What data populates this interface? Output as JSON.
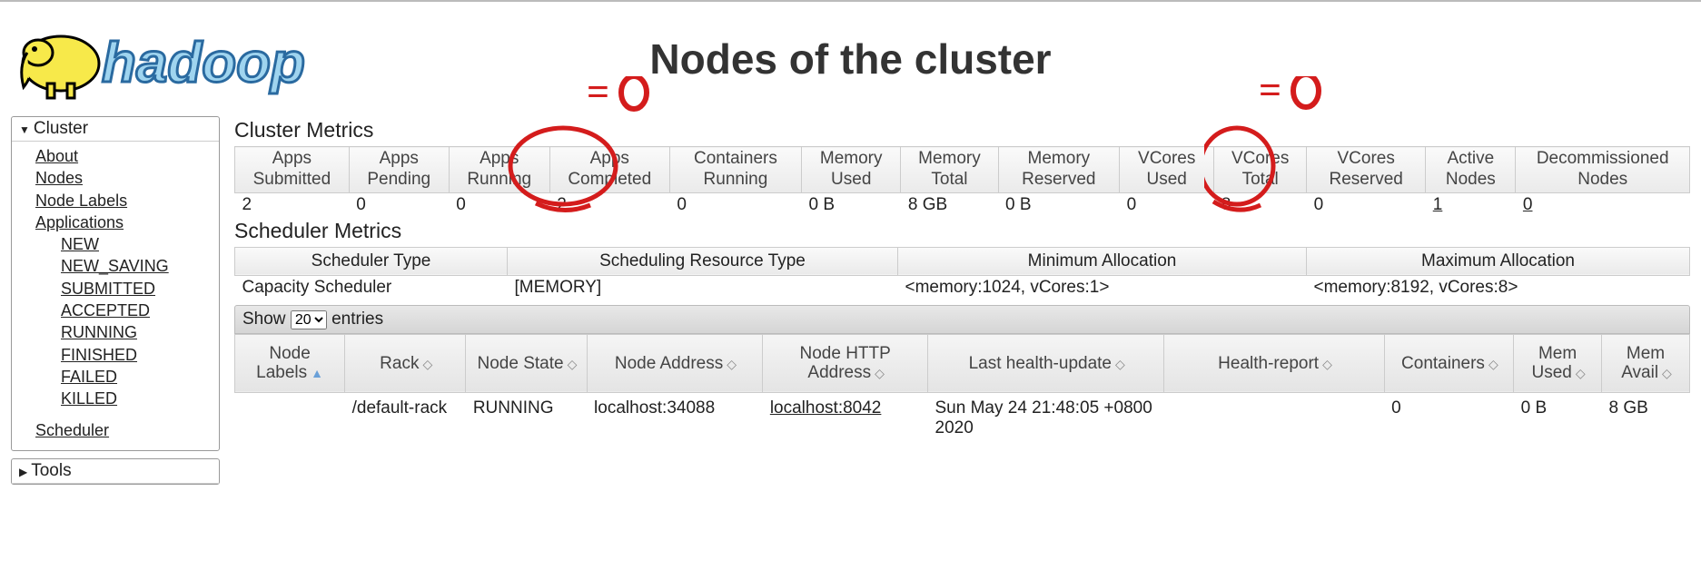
{
  "page_title": "Nodes of the cluster",
  "brand": "hadoop",
  "sidebar": {
    "cluster_header": "Cluster",
    "tools_header": "Tools",
    "links": {
      "about": "About",
      "nodes": "Nodes",
      "node_labels": "Node Labels",
      "applications": "Applications",
      "scheduler": "Scheduler"
    },
    "app_states": [
      "NEW",
      "NEW_SAVING",
      "SUBMITTED",
      "ACCEPTED",
      "RUNNING",
      "FINISHED",
      "FAILED",
      "KILLED"
    ]
  },
  "cluster_metrics": {
    "title": "Cluster Metrics",
    "headers": [
      "Apps Submitted",
      "Apps Pending",
      "Apps Running",
      "Apps Completed",
      "Containers Running",
      "Memory Used",
      "Memory Total",
      "Memory Reserved",
      "VCores Used",
      "VCores Total",
      "VCores Reserved",
      "Active Nodes",
      "Decommissioned Nodes"
    ],
    "row": [
      "2",
      "0",
      "0",
      "2",
      "0",
      "0 B",
      "8 GB",
      "0 B",
      "0",
      "8",
      "0",
      "1",
      "0"
    ]
  },
  "scheduler_metrics": {
    "title": "Scheduler Metrics",
    "headers": [
      "Scheduler Type",
      "Scheduling Resource Type",
      "Minimum Allocation",
      "Maximum Allocation"
    ],
    "row": [
      "Capacity Scheduler",
      "[MEMORY]",
      "<memory:1024, vCores:1>",
      "<memory:8192, vCores:8>"
    ]
  },
  "nodes_table": {
    "show_label_pre": "Show",
    "show_label_post": "entries",
    "show_value": "20",
    "headers": [
      "Node Labels",
      "Rack",
      "Node State",
      "Node Address",
      "Node HTTP Address",
      "Last health-update",
      "Health-report",
      "Containers",
      "Mem Used",
      "Mem Avail"
    ],
    "rows": [
      {
        "node_labels": "",
        "rack": "/default-rack",
        "node_state": "RUNNING",
        "node_address": "localhost:34088",
        "node_http_address": "localhost:8042",
        "last_health_update": "Sun May 24 21:48:05 +0800 2020",
        "health_report": "",
        "containers": "0",
        "mem_used": "0 B",
        "mem_avail": "8 GB"
      }
    ]
  },
  "annotations": {
    "eq_zero_1": "=0",
    "eq_zero_2": "=0"
  }
}
